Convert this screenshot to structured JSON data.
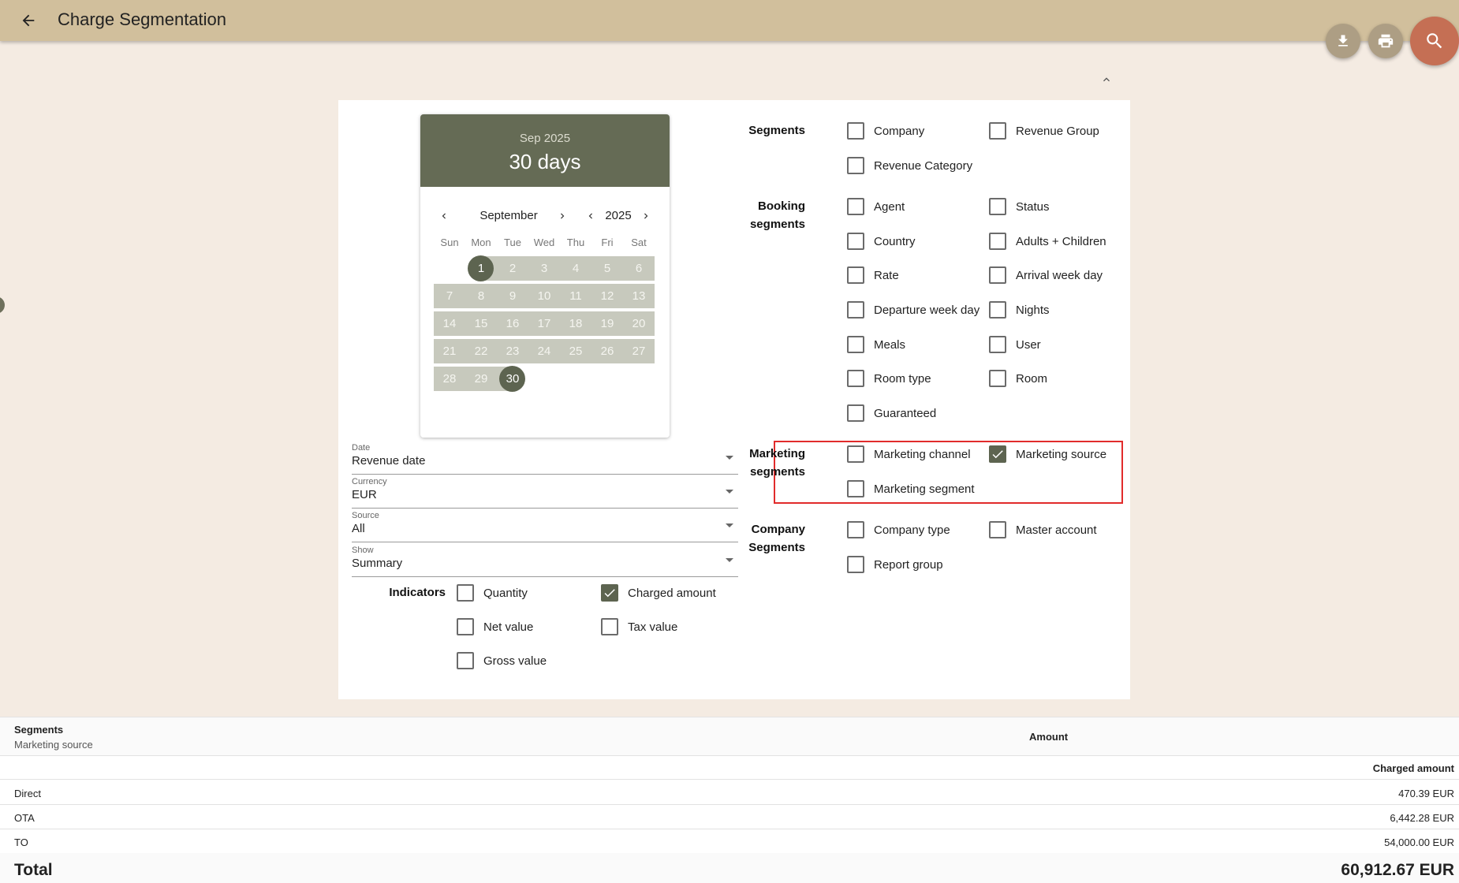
{
  "header": {
    "title": "Charge Segmentation",
    "back_icon": "arrow-left-icon"
  },
  "actions": {
    "download_icon": "download-icon",
    "print_icon": "print-icon",
    "search_icon": "search-icon"
  },
  "colors": {
    "appbar": "#d1bf9c",
    "background": "#f4ebe2",
    "calendar_header": "#656b55",
    "range": "#c7c9bd",
    "selected": "#5d6450",
    "search_fab": "#c56f54",
    "highlight": "#e12b2b"
  },
  "calendar": {
    "header_month": "Sep 2025",
    "header_days": "30 days",
    "month": "September",
    "year": "2025",
    "weekdays": [
      "Sun",
      "Mon",
      "Tue",
      "Wed",
      "Thu",
      "Fri",
      "Sat"
    ],
    "weeks": [
      [
        "",
        "1",
        "2",
        "3",
        "4",
        "5",
        "6"
      ],
      [
        "7",
        "8",
        "9",
        "10",
        "11",
        "12",
        "13"
      ],
      [
        "14",
        "15",
        "16",
        "17",
        "18",
        "19",
        "20"
      ],
      [
        "21",
        "22",
        "23",
        "24",
        "25",
        "26",
        "27"
      ],
      [
        "28",
        "29",
        "30",
        "",
        "",
        "",
        ""
      ]
    ],
    "range_start": "1",
    "range_end": "30"
  },
  "filters": {
    "date": {
      "label": "Date",
      "value": "Revenue date"
    },
    "currency": {
      "label": "Currency",
      "value": "EUR"
    },
    "source": {
      "label": "Source",
      "value": "All"
    },
    "show": {
      "label": "Show",
      "value": "Summary"
    }
  },
  "indicators": {
    "label": "Indicators",
    "items": [
      {
        "label": "Quantity",
        "checked": false
      },
      {
        "label": "Charged amount",
        "checked": true
      },
      {
        "label": "Net value",
        "checked": false
      },
      {
        "label": "Tax value",
        "checked": false
      },
      {
        "label": "Gross value",
        "checked": false
      }
    ]
  },
  "segments": {
    "label": "Segments",
    "items": [
      {
        "label": "Company",
        "checked": false
      },
      {
        "label": "Revenue Group",
        "checked": false
      },
      {
        "label": "Revenue Category",
        "checked": false
      }
    ]
  },
  "booking_segments": {
    "label_line1": "Booking",
    "label_line2": "segments",
    "items": [
      {
        "label": "Agent",
        "checked": false
      },
      {
        "label": "Status",
        "checked": false
      },
      {
        "label": "Country",
        "checked": false
      },
      {
        "label": "Adults + Children",
        "checked": false
      },
      {
        "label": "Rate",
        "checked": false
      },
      {
        "label": "Arrival week day",
        "checked": false
      },
      {
        "label": "Departure week day",
        "checked": false
      },
      {
        "label": "Nights",
        "checked": false
      },
      {
        "label": "Meals",
        "checked": false
      },
      {
        "label": "User",
        "checked": false
      },
      {
        "label": "Room type",
        "checked": false
      },
      {
        "label": "Room",
        "checked": false
      },
      {
        "label": "Guaranteed",
        "checked": false
      }
    ]
  },
  "marketing_segments": {
    "label_line1": "Marketing",
    "label_line2": "segments",
    "items": [
      {
        "label": "Marketing channel",
        "checked": false
      },
      {
        "label": "Marketing source",
        "checked": true
      },
      {
        "label": "Marketing segment",
        "checked": false
      }
    ]
  },
  "company_segments": {
    "label_line1": "Company",
    "label_line2": "Segments",
    "items": [
      {
        "label": "Company type",
        "checked": false
      },
      {
        "label": "Master account",
        "checked": false
      },
      {
        "label": "Report group",
        "checked": false
      }
    ]
  },
  "results": {
    "header_segments": "Segments",
    "header_segment_name": "Marketing source",
    "header_amount": "Amount",
    "sub_header": "Charged amount",
    "rows": [
      {
        "name": "Direct",
        "amount": "470.39 EUR"
      },
      {
        "name": "OTA",
        "amount": "6,442.28 EUR"
      },
      {
        "name": "TO",
        "amount": "54,000.00 EUR"
      }
    ],
    "total_label": "Total",
    "total_amount": "60,912.67 EUR"
  }
}
